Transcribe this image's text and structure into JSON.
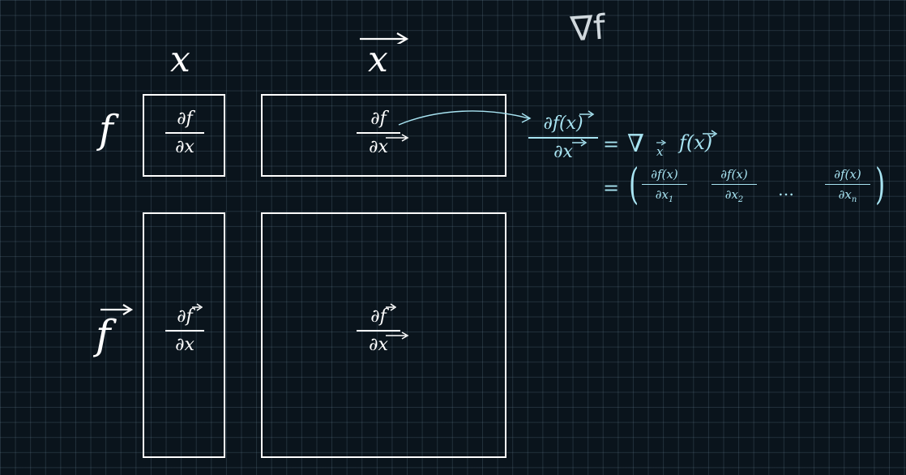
{
  "column_headers": {
    "x": "x",
    "vec_x": "x"
  },
  "row_headers": {
    "f": "f",
    "vec_f": "f"
  },
  "cells": {
    "f_x": {
      "num": "∂f",
      "den": "∂x"
    },
    "f_vx": {
      "num": "∂f",
      "den": "∂x"
    },
    "vf_x": {
      "num": "∂f",
      "den": "∂x"
    },
    "vf_vx": {
      "num": "∂f",
      "den": "∂x"
    }
  },
  "gradient": {
    "lhs_num": "∂f(x)",
    "lhs_den": "∂x",
    "eq1": "=",
    "nabla": "∇",
    "nabla_sub": "x",
    "rhs1": "f(x)",
    "eq2": "=",
    "terms": [
      {
        "num": "∂f(x)",
        "den": "∂x",
        "sub": "1"
      },
      {
        "num": "∂f(x)",
        "den": "∂x",
        "sub": "2"
      },
      {
        "num": "∂f(x)",
        "den": "∂x",
        "sub": "n"
      }
    ],
    "ellipsis": "…"
  },
  "annotation": "∇f",
  "colors": {
    "background": "#0a141c",
    "grid": "#4d6170",
    "ink": "#ffffff",
    "accent": "#a8e4f2"
  }
}
